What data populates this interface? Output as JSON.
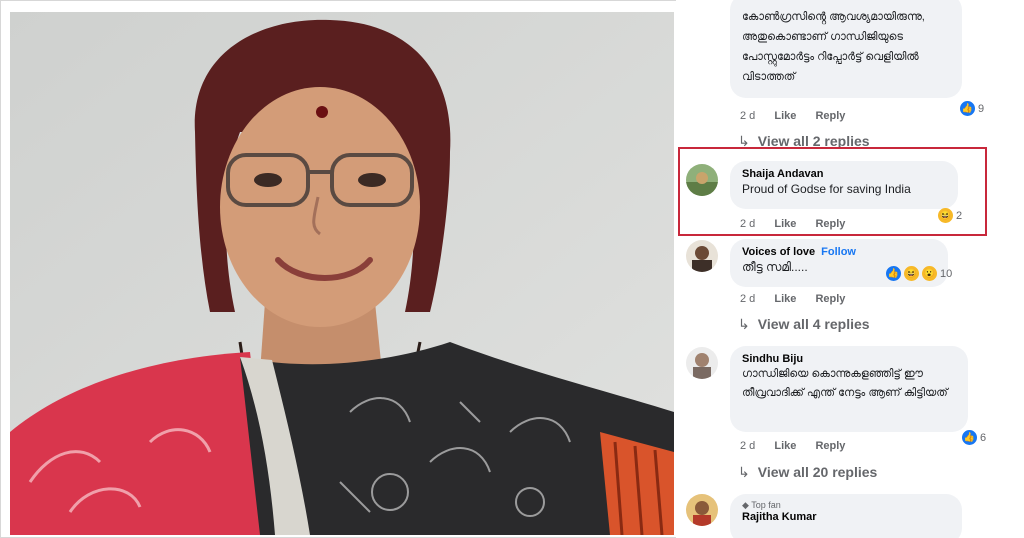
{
  "comments": [
    {
      "text": "കോൺഗ്രസിൻ്റെ ആവശ്യമായിരുന്നു, അതുകൊണ്ടാണ് ഗാന്ധിജിയുടെ പോസ്റ്റുമോർട്ടം റിപ്പോർട്ട് വെളിയിൽ വിടാത്തത്",
      "time": "2 d",
      "like": "Like",
      "reply": "Reply",
      "reaction_count": "9",
      "view_replies": "View all 2 replies"
    },
    {
      "name": "Shaija Andavan",
      "text": "Proud of Godse for saving India",
      "time": "2 d",
      "like": "Like",
      "reply": "Reply",
      "reaction_count": "2"
    },
    {
      "name": "Voices of love",
      "follow": "Follow",
      "text": "തീട്ട സമി.....",
      "time": "2 d",
      "like": "Like",
      "reply": "Reply",
      "reaction_count": "10",
      "view_replies": "View all 4 replies"
    },
    {
      "name": "Sindhu Biju",
      "text": "ഗാന്ധിജിയെ കൊന്നുകളഞ്ഞിട്ട് ഈ തീവ്രവാദിക്ക് എന്ത് നേട്ടം ആണ് കിട്ടിയത്",
      "time": "2 d",
      "like": "Like",
      "reply": "Reply",
      "reaction_count": "6",
      "view_replies": "View all 20 replies"
    },
    {
      "badge": "Top fan",
      "name": "Rajitha Kumar"
    }
  ],
  "colors": {
    "highlight": "#c8283b",
    "like_blue": "#1877f2",
    "bubble": "#f0f2f5"
  }
}
